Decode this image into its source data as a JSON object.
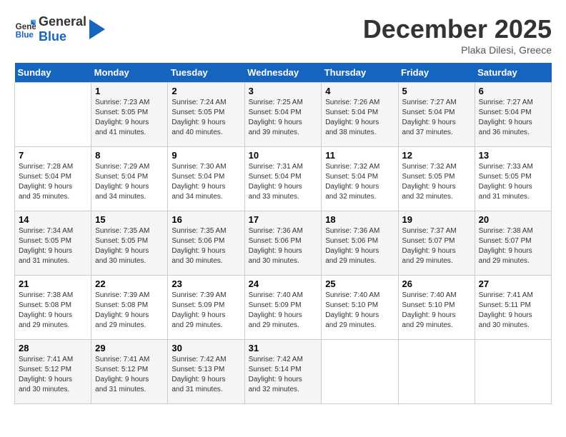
{
  "header": {
    "logo_line1": "General",
    "logo_line2": "Blue",
    "month": "December 2025",
    "location": "Plaka Dilesi, Greece"
  },
  "weekdays": [
    "Sunday",
    "Monday",
    "Tuesday",
    "Wednesday",
    "Thursday",
    "Friday",
    "Saturday"
  ],
  "weeks": [
    [
      {
        "day": "",
        "info": ""
      },
      {
        "day": "1",
        "info": "Sunrise: 7:23 AM\nSunset: 5:05 PM\nDaylight: 9 hours\nand 41 minutes."
      },
      {
        "day": "2",
        "info": "Sunrise: 7:24 AM\nSunset: 5:05 PM\nDaylight: 9 hours\nand 40 minutes."
      },
      {
        "day": "3",
        "info": "Sunrise: 7:25 AM\nSunset: 5:04 PM\nDaylight: 9 hours\nand 39 minutes."
      },
      {
        "day": "4",
        "info": "Sunrise: 7:26 AM\nSunset: 5:04 PM\nDaylight: 9 hours\nand 38 minutes."
      },
      {
        "day": "5",
        "info": "Sunrise: 7:27 AM\nSunset: 5:04 PM\nDaylight: 9 hours\nand 37 minutes."
      },
      {
        "day": "6",
        "info": "Sunrise: 7:27 AM\nSunset: 5:04 PM\nDaylight: 9 hours\nand 36 minutes."
      }
    ],
    [
      {
        "day": "7",
        "info": "Sunrise: 7:28 AM\nSunset: 5:04 PM\nDaylight: 9 hours\nand 35 minutes."
      },
      {
        "day": "8",
        "info": "Sunrise: 7:29 AM\nSunset: 5:04 PM\nDaylight: 9 hours\nand 34 minutes."
      },
      {
        "day": "9",
        "info": "Sunrise: 7:30 AM\nSunset: 5:04 PM\nDaylight: 9 hours\nand 34 minutes."
      },
      {
        "day": "10",
        "info": "Sunrise: 7:31 AM\nSunset: 5:04 PM\nDaylight: 9 hours\nand 33 minutes."
      },
      {
        "day": "11",
        "info": "Sunrise: 7:32 AM\nSunset: 5:04 PM\nDaylight: 9 hours\nand 32 minutes."
      },
      {
        "day": "12",
        "info": "Sunrise: 7:32 AM\nSunset: 5:05 PM\nDaylight: 9 hours\nand 32 minutes."
      },
      {
        "day": "13",
        "info": "Sunrise: 7:33 AM\nSunset: 5:05 PM\nDaylight: 9 hours\nand 31 minutes."
      }
    ],
    [
      {
        "day": "14",
        "info": "Sunrise: 7:34 AM\nSunset: 5:05 PM\nDaylight: 9 hours\nand 31 minutes."
      },
      {
        "day": "15",
        "info": "Sunrise: 7:35 AM\nSunset: 5:05 PM\nDaylight: 9 hours\nand 30 minutes."
      },
      {
        "day": "16",
        "info": "Sunrise: 7:35 AM\nSunset: 5:06 PM\nDaylight: 9 hours\nand 30 minutes."
      },
      {
        "day": "17",
        "info": "Sunrise: 7:36 AM\nSunset: 5:06 PM\nDaylight: 9 hours\nand 30 minutes."
      },
      {
        "day": "18",
        "info": "Sunrise: 7:36 AM\nSunset: 5:06 PM\nDaylight: 9 hours\nand 29 minutes."
      },
      {
        "day": "19",
        "info": "Sunrise: 7:37 AM\nSunset: 5:07 PM\nDaylight: 9 hours\nand 29 minutes."
      },
      {
        "day": "20",
        "info": "Sunrise: 7:38 AM\nSunset: 5:07 PM\nDaylight: 9 hours\nand 29 minutes."
      }
    ],
    [
      {
        "day": "21",
        "info": "Sunrise: 7:38 AM\nSunset: 5:08 PM\nDaylight: 9 hours\nand 29 minutes."
      },
      {
        "day": "22",
        "info": "Sunrise: 7:39 AM\nSunset: 5:08 PM\nDaylight: 9 hours\nand 29 minutes."
      },
      {
        "day": "23",
        "info": "Sunrise: 7:39 AM\nSunset: 5:09 PM\nDaylight: 9 hours\nand 29 minutes."
      },
      {
        "day": "24",
        "info": "Sunrise: 7:40 AM\nSunset: 5:09 PM\nDaylight: 9 hours\nand 29 minutes."
      },
      {
        "day": "25",
        "info": "Sunrise: 7:40 AM\nSunset: 5:10 PM\nDaylight: 9 hours\nand 29 minutes."
      },
      {
        "day": "26",
        "info": "Sunrise: 7:40 AM\nSunset: 5:10 PM\nDaylight: 9 hours\nand 29 minutes."
      },
      {
        "day": "27",
        "info": "Sunrise: 7:41 AM\nSunset: 5:11 PM\nDaylight: 9 hours\nand 30 minutes."
      }
    ],
    [
      {
        "day": "28",
        "info": "Sunrise: 7:41 AM\nSunset: 5:12 PM\nDaylight: 9 hours\nand 30 minutes."
      },
      {
        "day": "29",
        "info": "Sunrise: 7:41 AM\nSunset: 5:12 PM\nDaylight: 9 hours\nand 31 minutes."
      },
      {
        "day": "30",
        "info": "Sunrise: 7:42 AM\nSunset: 5:13 PM\nDaylight: 9 hours\nand 31 minutes."
      },
      {
        "day": "31",
        "info": "Sunrise: 7:42 AM\nSunset: 5:14 PM\nDaylight: 9 hours\nand 32 minutes."
      },
      {
        "day": "",
        "info": ""
      },
      {
        "day": "",
        "info": ""
      },
      {
        "day": "",
        "info": ""
      }
    ]
  ]
}
